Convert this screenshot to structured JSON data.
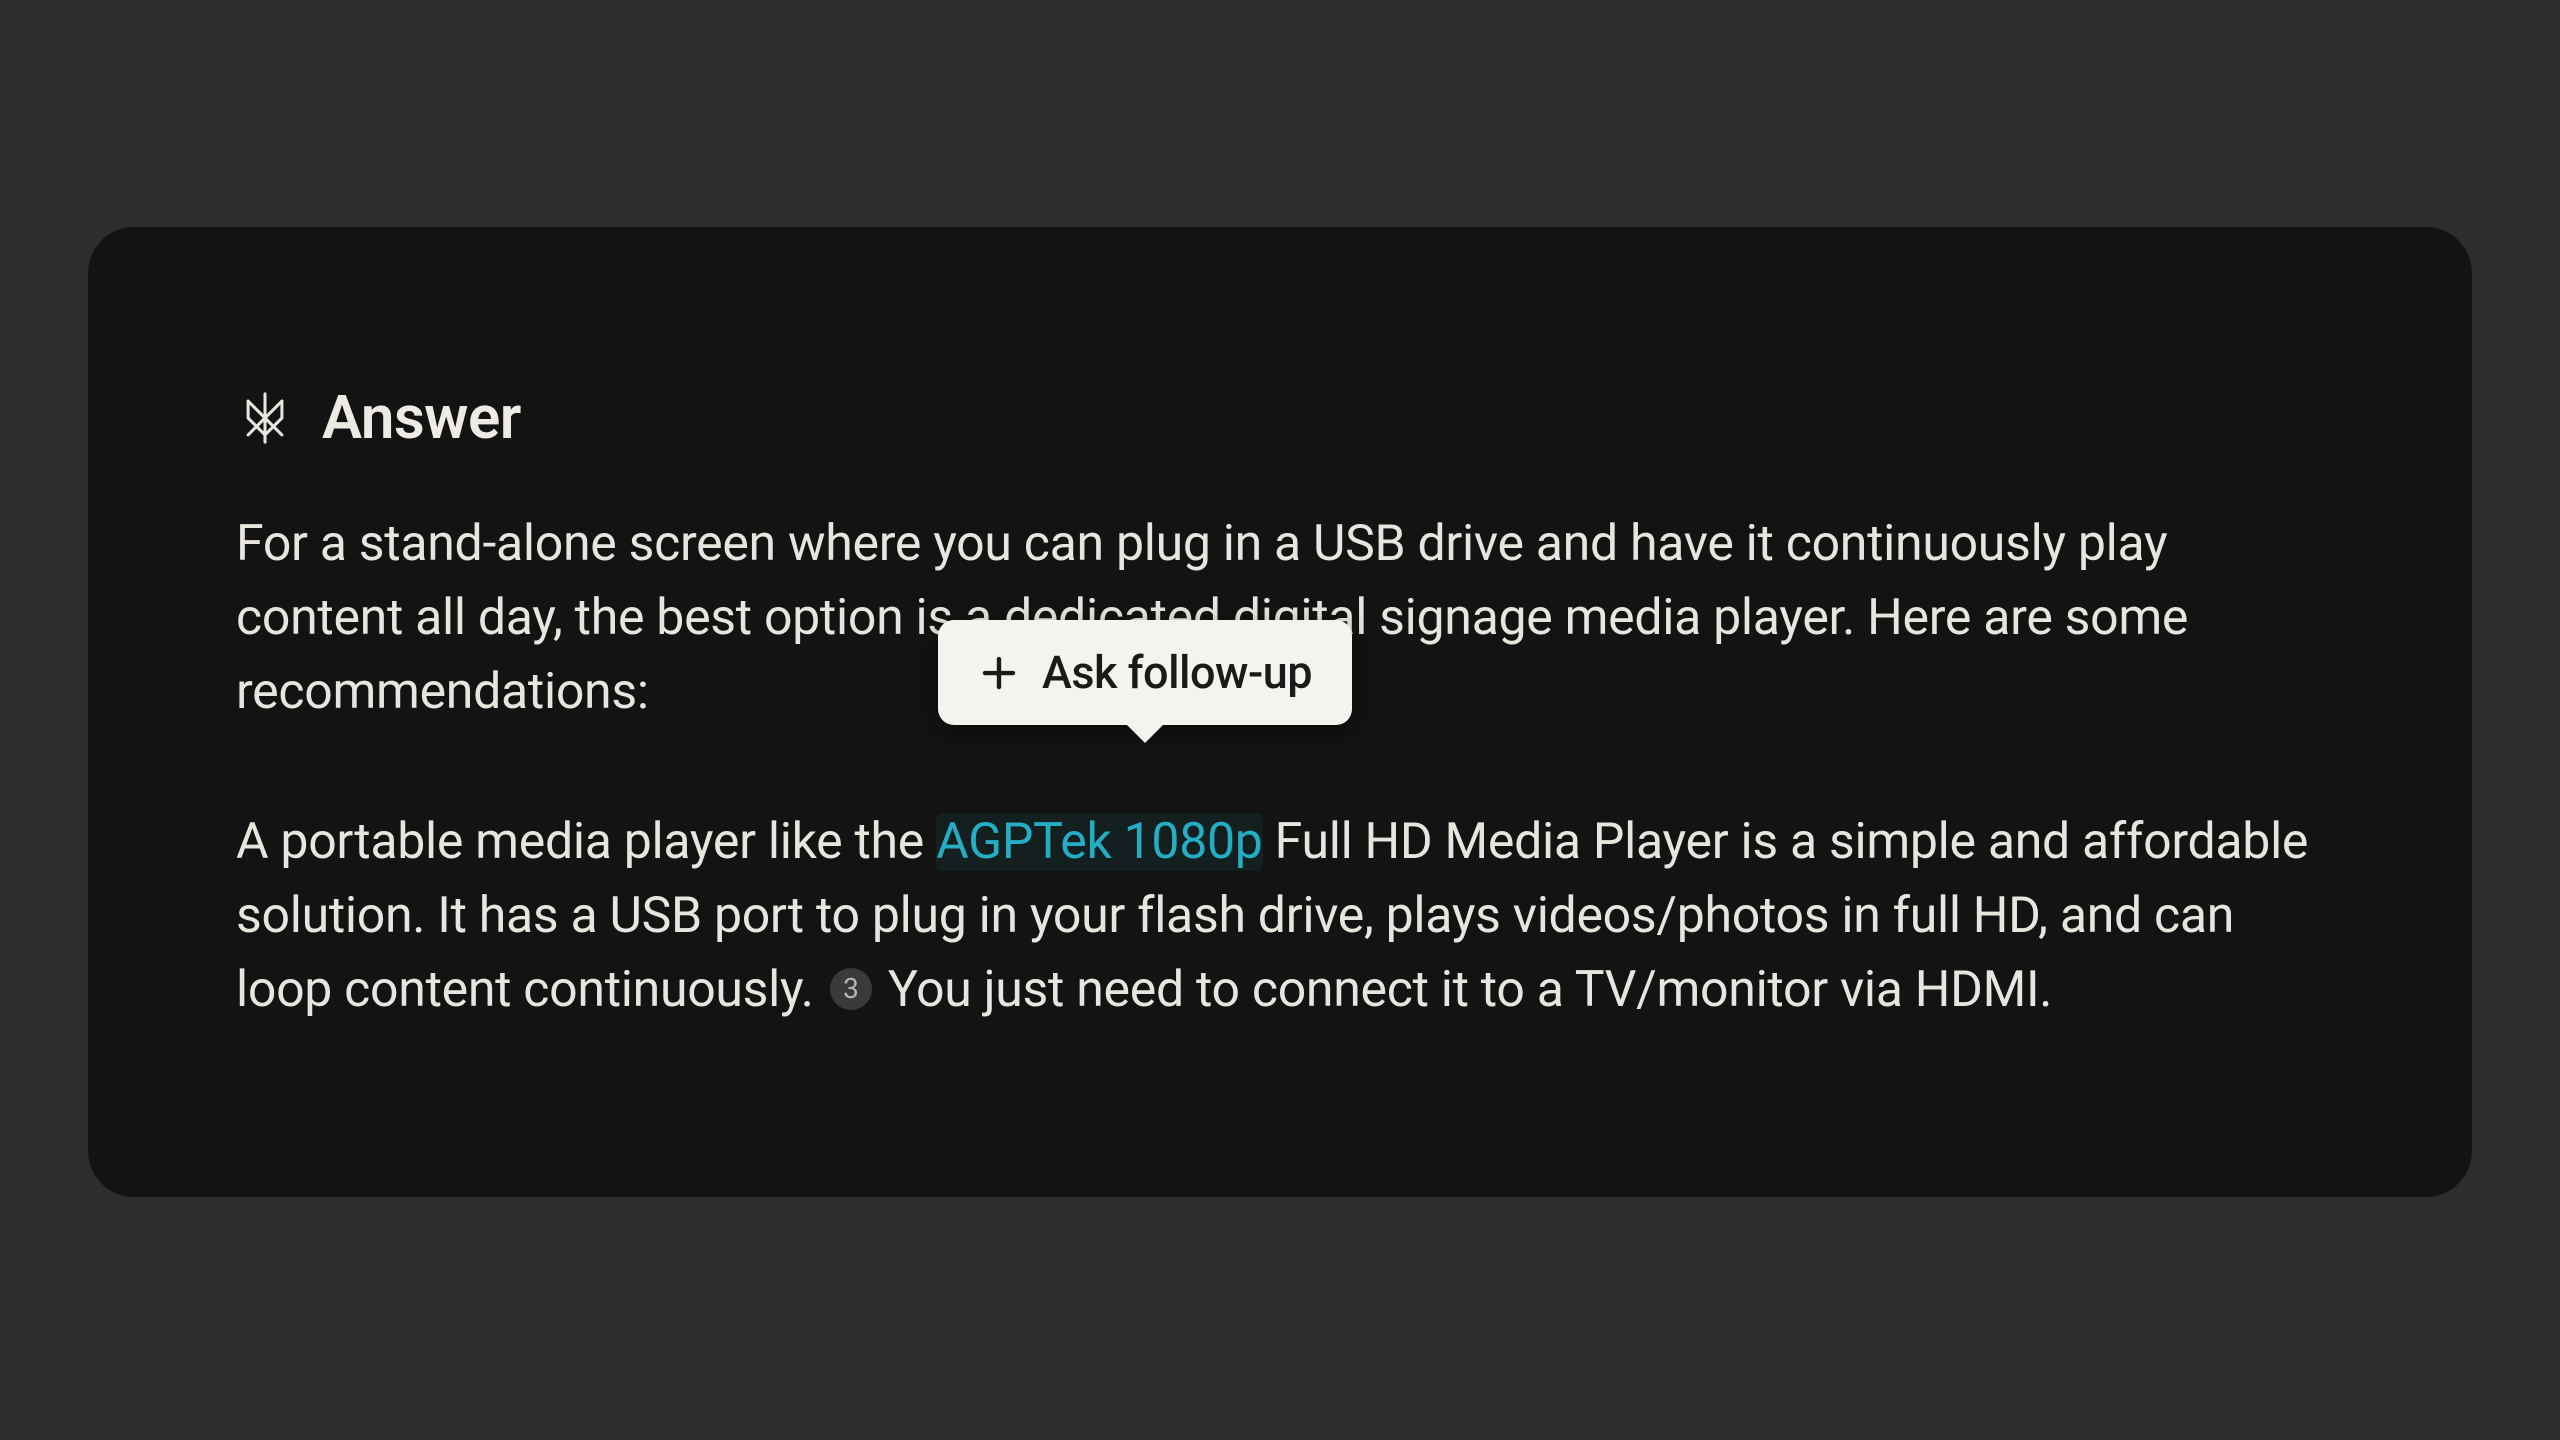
{
  "answer": {
    "title": "Answer",
    "paragraphs": {
      "p1": "For a stand-alone screen where you can plug in a USB drive and have it continuously play content all day, the best option is a dedicated digital signage media player. Here are some recommendations:",
      "p2_part1": "A portable media player like the ",
      "p2_link": "AGPTek 1080p",
      "p2_part2": " Full HD Media Player is a simple and affordable solution. It has a USB port to plug in your flash drive, plays videos/photos in full HD, and can loop content continuously. ",
      "p2_citation": "3",
      "p2_part3": " You just need to connect it to a TV/monitor via HDMI."
    }
  },
  "followup": {
    "label": "Ask follow-up"
  }
}
